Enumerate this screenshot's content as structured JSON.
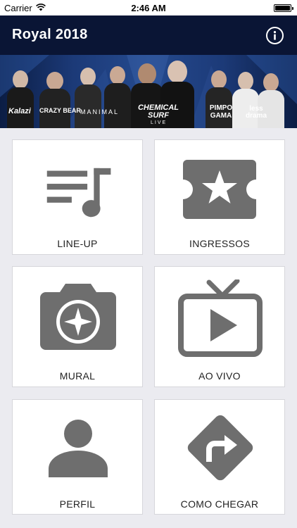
{
  "status_bar": {
    "carrier": "Carrier",
    "time": "2:46 AM"
  },
  "nav": {
    "title": "Royal 2018"
  },
  "banner": {
    "artists": [
      "Kalazi",
      "CRAZY BEAR",
      "MANIMAL",
      "CHEMICAL SURF",
      "PIMPO GAMA",
      "less drama"
    ],
    "sub_label": "LIVE"
  },
  "menu": {
    "items": [
      {
        "label": "LINE-UP",
        "icon": "music-list-icon"
      },
      {
        "label": "INGRESSOS",
        "icon": "ticket-star-icon"
      },
      {
        "label": "MURAL",
        "icon": "camera-icon"
      },
      {
        "label": "AO VIVO",
        "icon": "tv-play-icon"
      },
      {
        "label": "PERFIL",
        "icon": "person-icon"
      },
      {
        "label": "COMO CHEGAR",
        "icon": "directions-sign-icon"
      }
    ]
  },
  "colors": {
    "nav_background": "#0a1535",
    "icon_gray": "#6e6e6e",
    "page_background": "#ebebf0"
  }
}
